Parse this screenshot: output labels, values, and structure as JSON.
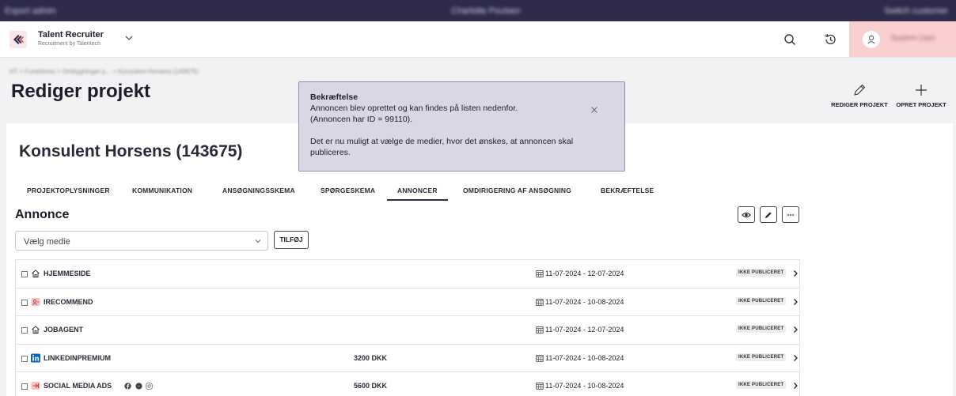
{
  "topbar": {
    "left_text": "Export admin",
    "center_text": "Charlotte Poulsen",
    "right_text": "Switch customer"
  },
  "app": {
    "brand_name": "Talent Recruiter",
    "brand_sub": "Recruitment by Talentech",
    "user_name": "System User",
    "accent": "#2e2c4a",
    "user_area_color": "#f9cfcf"
  },
  "breadcrumb": "HT > Fundstone > Ombygninger p... > Konsulent Horsens (143675)",
  "page_title": "Rediger projekt",
  "actions": {
    "edit_project": "REDIGER PROJEKT",
    "create_project": "OPRET PROJEKT"
  },
  "project_title": "Konsulent Horsens (143675)",
  "tabs": [
    {
      "label": "PROJEKTOPLYSNINGER",
      "active": false
    },
    {
      "label": "KOMMUNIKATION",
      "active": false
    },
    {
      "label": "ANSØGNINGSSKEMA",
      "active": false
    },
    {
      "label": "SPØRGESKEMA",
      "active": false
    },
    {
      "label": "ANNONCER",
      "active": true
    },
    {
      "label": "OMDIRIGERING AF ANSØGNING",
      "active": false
    },
    {
      "label": "BEKRÆFTELSE",
      "active": false
    }
  ],
  "section": {
    "title": "Annonce",
    "select_value": "Vælg medie",
    "add_label": "TILFØJ"
  },
  "media_rows": [
    {
      "icon": "home-icon",
      "name": "HJEMMESIDE",
      "price": "",
      "dates": "11-07-2024 - 12-07-2024",
      "status": "IKKE PUBLICERET"
    },
    {
      "icon": "irecommend-icon",
      "name": "IRECOMMEND",
      "price": "",
      "dates": "11-07-2024 - 10-08-2024",
      "status": "IKKE PUBLICERET"
    },
    {
      "icon": "home-icon",
      "name": "JOBAGENT",
      "price": "",
      "dates": "11-07-2024 - 12-07-2024",
      "status": "IKKE PUBLICERET"
    },
    {
      "icon": "linkedin-icon",
      "name": "LINKEDINPREMIUM",
      "price": "3200 DKK",
      "dates": "11-07-2024 - 10-08-2024",
      "status": "IKKE PUBLICERET"
    },
    {
      "icon": "social-media-icon",
      "name": "SOCIAL MEDIA ADS",
      "price": "5600 DKK",
      "dates": "11-07-2024 - 10-08-2024",
      "status": "IKKE PUBLICERET"
    }
  ],
  "toast": {
    "title": "Bekræftelse",
    "line1": "Annoncen blev oprettet og kan findes på listen nedenfor.",
    "line2": "(Annoncen har ID = 99110).",
    "line3": "Det er nu muligt at vælge de medier, hvor det ønskes, at annoncen skal",
    "line4": "publiceres."
  }
}
